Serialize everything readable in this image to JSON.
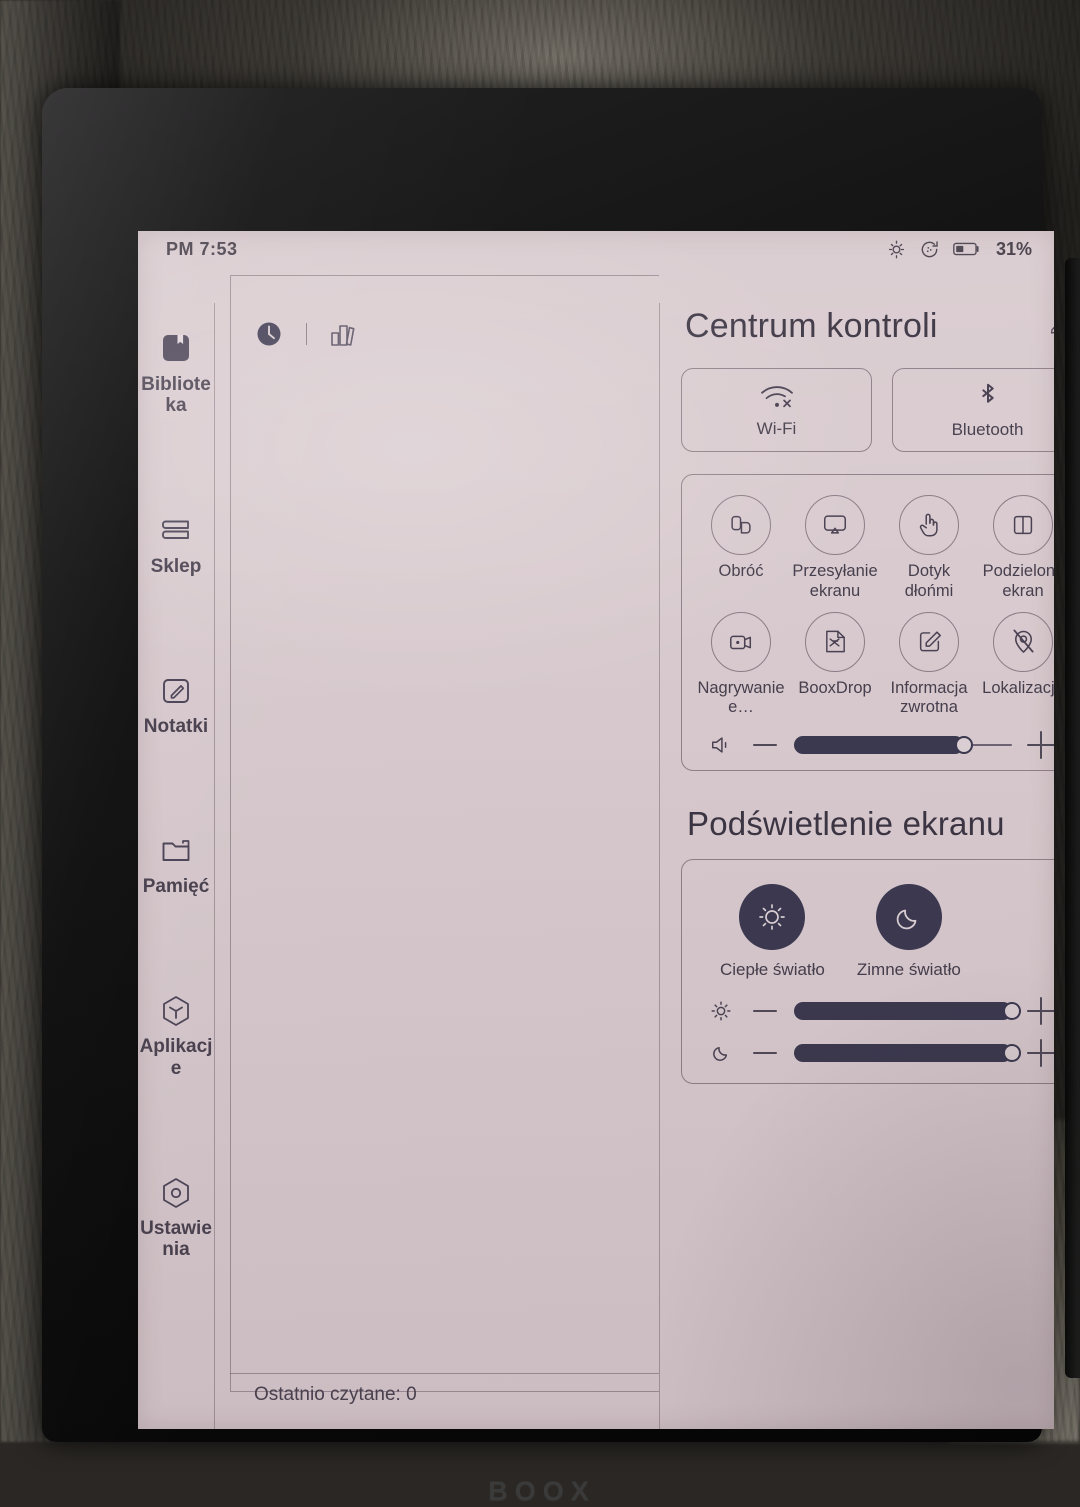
{
  "device": {
    "brand": "BOOX"
  },
  "status_bar": {
    "time": "PM 7:53",
    "battery_percent": "31%",
    "icons": [
      "brightness-icon",
      "refresh-icon",
      "battery-icon"
    ]
  },
  "sidebar": {
    "items": [
      {
        "label": "Biblioteka",
        "icon": "library-icon",
        "active": true
      },
      {
        "label": "Sklep",
        "icon": "store-icon",
        "active": false
      },
      {
        "label": "Notatki",
        "icon": "notes-icon",
        "active": false
      },
      {
        "label": "Pamięć",
        "icon": "storage-icon",
        "active": false
      },
      {
        "label": "Aplikacje",
        "icon": "apps-icon",
        "active": false
      },
      {
        "label": "Ustawienia",
        "icon": "settings-icon",
        "active": false
      }
    ]
  },
  "library": {
    "tabs": [
      {
        "icon": "clock-icon",
        "active": true
      },
      {
        "icon": "books-icon",
        "active": false
      }
    ],
    "footer_text": "Ostatnio czytane: 0"
  },
  "control_center": {
    "title": "Centrum kontroli",
    "edit_icon": "pencil-icon",
    "big_toggles": [
      {
        "label": "Wi-Fi",
        "icon": "wifi-off-icon",
        "enabled": false
      },
      {
        "label": "Bluetooth",
        "icon": "bluetooth-icon",
        "enabled": false
      }
    ],
    "tiles": [
      {
        "label": "Obróć",
        "icon": "rotate-icon"
      },
      {
        "label": "Przesyłanie ekranu",
        "icon": "cast-screen-icon"
      },
      {
        "label": "Dotyk dłońmi",
        "icon": "palm-touch-icon"
      },
      {
        "label": "Podzielony ekran",
        "icon": "split-screen-icon"
      },
      {
        "label": "Nagrywanie e…",
        "icon": "screen-record-icon"
      },
      {
        "label": "BooxDrop",
        "icon": "booxdrop-icon"
      },
      {
        "label": "Informacja zwrotna",
        "icon": "feedback-icon"
      },
      {
        "label": "Lokalizacja",
        "icon": "location-off-icon"
      }
    ],
    "volume_slider": {
      "icon": "volume-icon",
      "minus": "−",
      "plus": "+",
      "value_percent": 78
    }
  },
  "backlight": {
    "title": "Podświetlenie ekranu",
    "modes": [
      {
        "label": "Ciepłe światło",
        "icon": "warm-light-icon"
      },
      {
        "label": "Zimne światło",
        "icon": "cold-light-icon"
      }
    ],
    "sliders": [
      {
        "icon": "warm-light-icon",
        "minus": "−",
        "plus": "+",
        "value_percent": 100
      },
      {
        "icon": "cold-light-icon",
        "minus": "−",
        "plus": "+",
        "value_percent": 100
      }
    ]
  },
  "colors": {
    "screen_bg": "#d9cbcf",
    "ink": "#3c3640",
    "accent_dark": "#3b3950",
    "bezel": "#0a0a0a"
  }
}
